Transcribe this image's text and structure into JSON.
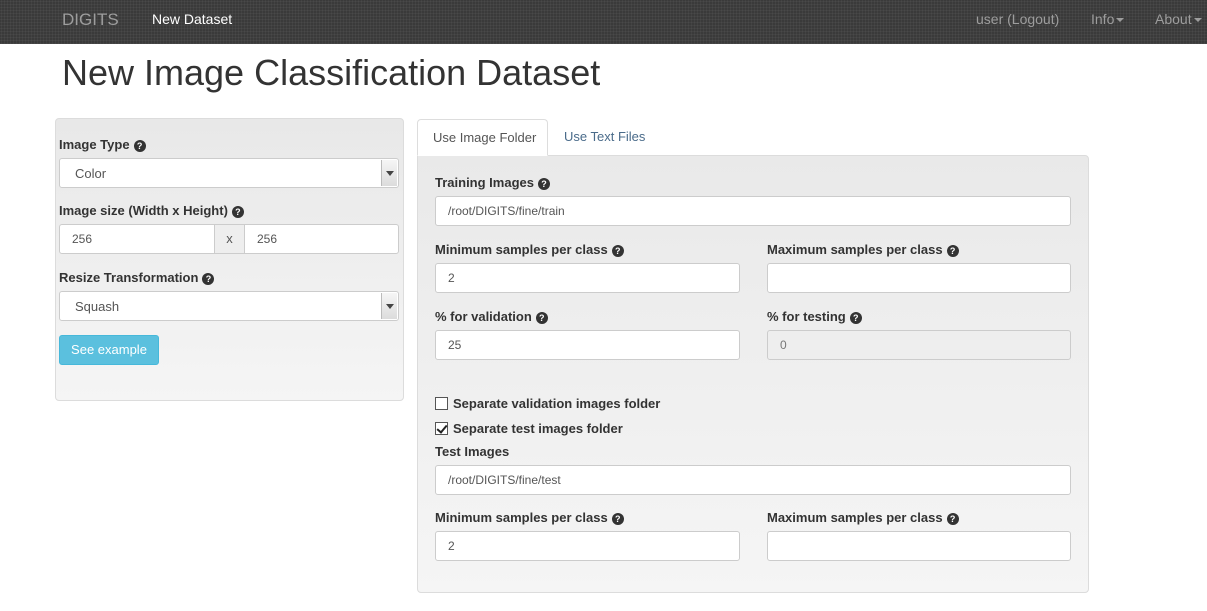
{
  "navbar": {
    "brand": "DIGITS",
    "new_dataset": "New Dataset",
    "user": "user (Logout)",
    "info": "Info",
    "about": "About"
  },
  "page_title": "New Image Classification Dataset",
  "left_panel": {
    "image_type_label": "Image Type",
    "image_type_value": "Color",
    "image_size_label": "Image size (Width x Height)",
    "width_value": "256",
    "x_separator": "x",
    "height_value": "256",
    "resize_label": "Resize Transformation",
    "resize_value": "Squash",
    "see_example": "See example"
  },
  "tabs": [
    {
      "label": "Use Image Folder",
      "active": true
    },
    {
      "label": "Use Text Files",
      "active": false
    }
  ],
  "form": {
    "training_images_label": "Training Images",
    "training_images_value": "/root/DIGITS/fine/train",
    "min_samples_label": "Minimum samples per class",
    "min_samples_value": "2",
    "max_samples_label": "Maximum samples per class",
    "max_samples_value": "",
    "pct_validation_label": "% for validation",
    "pct_validation_value": "25",
    "pct_testing_label": "% for testing",
    "pct_testing_value": "0",
    "separate_validation_label": "Separate validation images folder",
    "separate_validation_checked": false,
    "separate_test_label": "Separate test images folder",
    "separate_test_checked": true,
    "test_images_label": "Test Images",
    "test_images_value": "/root/DIGITS/fine/test",
    "test_min_samples_label": "Minimum samples per class",
    "test_min_samples_value": "2",
    "test_max_samples_label": "Maximum samples per class",
    "test_max_samples_value": ""
  },
  "icons": {
    "help": "question-circle-icon",
    "dropdown": "caret-down-icon",
    "checkbox": "checkbox-icon"
  }
}
